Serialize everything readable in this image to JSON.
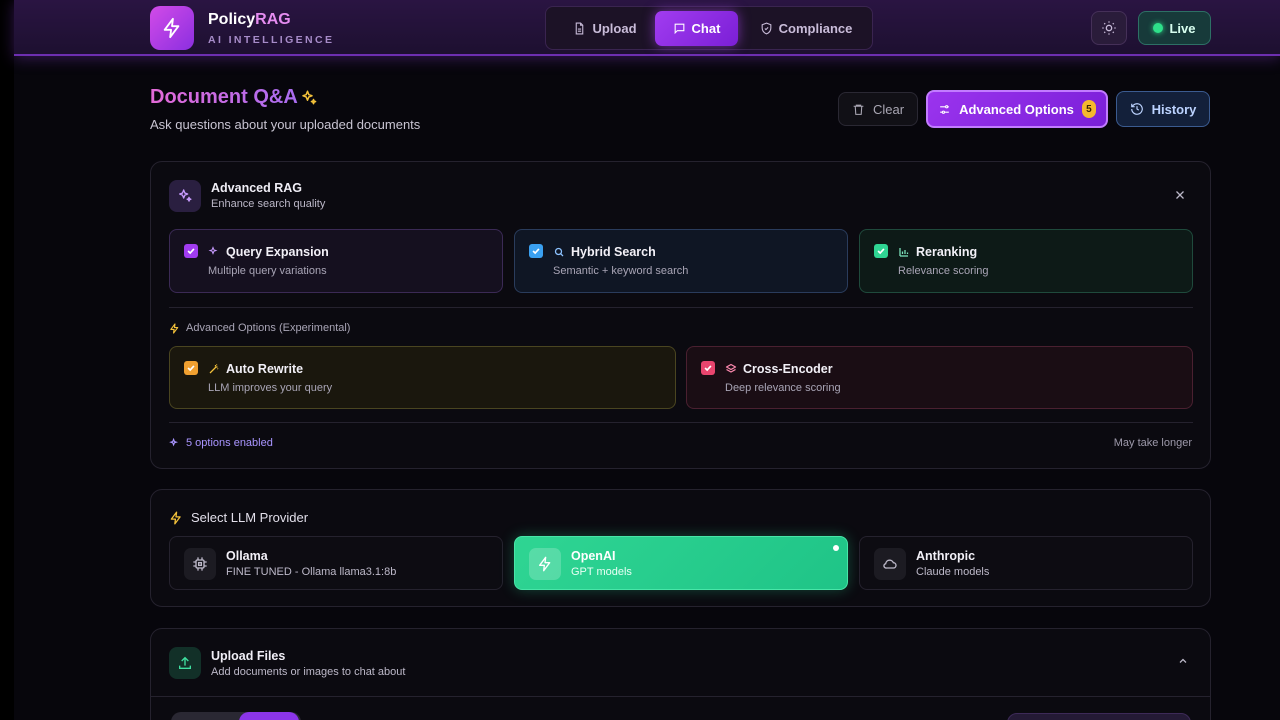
{
  "brand": {
    "name_main": "Policy",
    "name_accent": "RAG",
    "tagline": "AI INTELLIGENCE"
  },
  "nav": {
    "tabs": [
      {
        "label": "Upload",
        "icon": "file-icon",
        "active": false
      },
      {
        "label": "Chat",
        "icon": "chat-icon",
        "active": true
      },
      {
        "label": "Compliance",
        "icon": "shield-icon",
        "active": false
      }
    ]
  },
  "status": {
    "live_label": "Live",
    "live_color": "#2ee08a"
  },
  "page": {
    "title": "Document Q&A",
    "subtitle": "Ask questions about your uploaded documents"
  },
  "actions": {
    "clear_label": "Clear",
    "advanced_label": "Advanced Options",
    "advanced_count": "5",
    "history_label": "History"
  },
  "advanced_rag": {
    "title": "Advanced RAG",
    "subtitle": "Enhance search quality",
    "options": [
      {
        "title": "Query Expansion",
        "desc": "Multiple query variations",
        "checked": true,
        "color": "#a13cf0"
      },
      {
        "title": "Hybrid Search",
        "desc": "Semantic + keyword search",
        "checked": true,
        "color": "#3aa0f0"
      },
      {
        "title": "Reranking",
        "desc": "Relevance scoring",
        "checked": true,
        "color": "#2fd593"
      }
    ],
    "experimental_label": "Advanced Options (Experimental)",
    "experimental": [
      {
        "title": "Auto Rewrite",
        "desc": "LLM improves your query",
        "checked": true,
        "color": "#f0a030"
      },
      {
        "title": "Cross-Encoder",
        "desc": "Deep relevance scoring",
        "checked": true,
        "color": "#e8456e"
      }
    ],
    "enabled_label": "5 options enabled",
    "warning_label": "May take longer"
  },
  "llm": {
    "title": "Select LLM Provider",
    "providers": [
      {
        "name": "Ollama",
        "desc": "FINE TUNED - Ollama llama3.1:8b",
        "icon": "cpu-icon",
        "active": false
      },
      {
        "name": "OpenAI",
        "desc": "GPT models",
        "icon": "bolt-icon",
        "active": true
      },
      {
        "name": "Anthropic",
        "desc": "Claude models",
        "icon": "cloud-icon",
        "active": false
      }
    ]
  },
  "upload": {
    "title": "Upload Files",
    "subtitle": "Add documents or images to chat about"
  }
}
